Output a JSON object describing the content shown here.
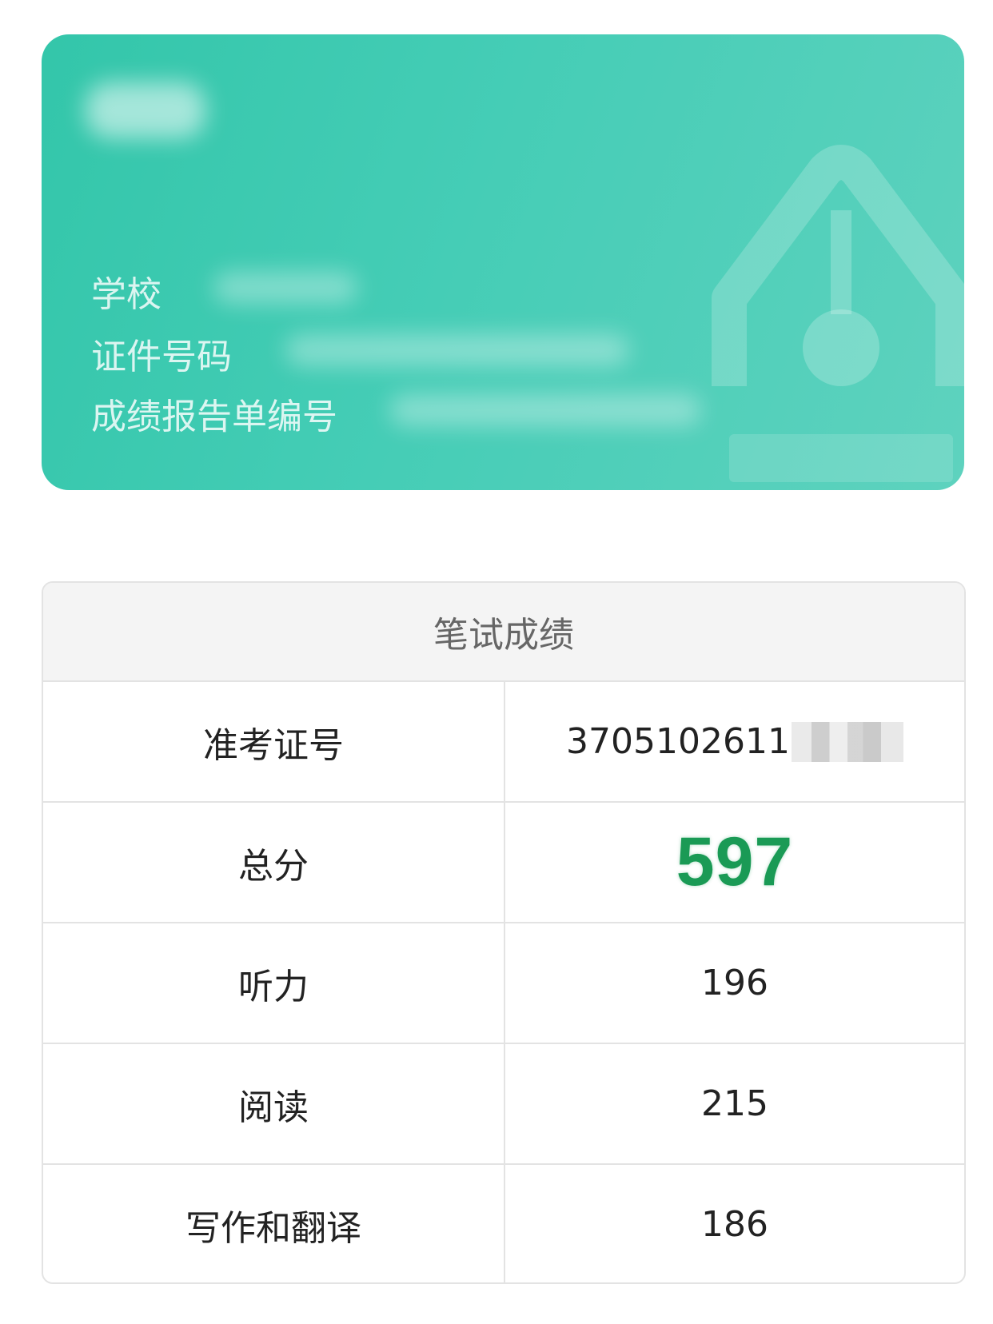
{
  "card": {
    "rows": [
      {
        "label": "学校"
      },
      {
        "label": "证件号码"
      },
      {
        "label": "成绩报告单编号"
      }
    ]
  },
  "score_table": {
    "title": "笔试成绩",
    "rows": [
      {
        "label": "准考证号",
        "value": "3705102611"
      },
      {
        "label": "总分",
        "value": "597"
      },
      {
        "label": "听力",
        "value": "196"
      },
      {
        "label": "阅读",
        "value": "215"
      },
      {
        "label": "写作和翻译",
        "value": "186"
      }
    ]
  },
  "colors": {
    "card_green": "#3fcab1",
    "total_score_green": "#1a9a55"
  },
  "icons": {
    "card_watermark": "pen-nib-icon"
  }
}
